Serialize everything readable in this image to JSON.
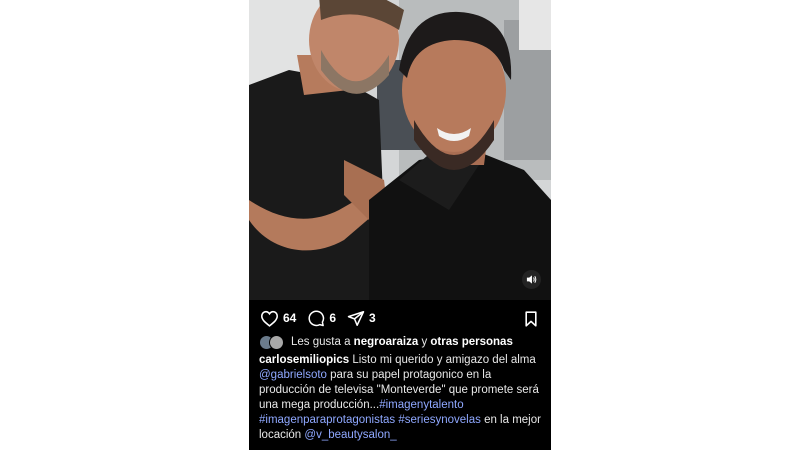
{
  "post": {
    "media_description": "photo",
    "actions": {
      "like_count": "64",
      "comment_count": "6",
      "share_count": "3"
    },
    "liked_by": {
      "prefix": "Les gusta a",
      "user": "negroaraiza",
      "connector": "y",
      "others": "otras personas"
    },
    "caption": {
      "username": "carlosemiliopics",
      "line1_text": "Listo mi querido y  amigazo del alma",
      "line2_mention": "@gabrielsoto",
      "line2_text": "para su papel protagonico en la",
      "line3_text": "producción de televisa \"Monteverde\" que promete será",
      "line4_text": "una mega producción...",
      "line4_tag": "#imagenytalento",
      "line5_tag1": "#imagenparaprotagonistas",
      "line5_tag2": "#seriesynovelas",
      "line5_text": "en la mejor",
      "line6_text": "locación",
      "line6_mention": "@v_beautysalon_"
    }
  },
  "colors": {
    "background": "#000000",
    "text": "#e8e8e8",
    "link": "#8fa8ff"
  }
}
